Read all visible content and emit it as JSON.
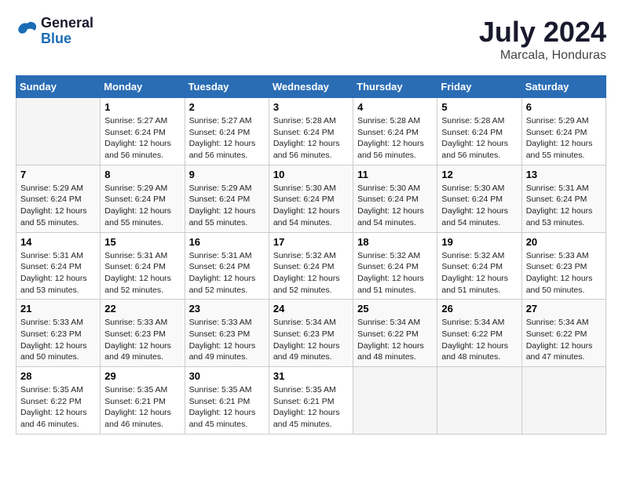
{
  "logo": {
    "line1": "General",
    "line2": "Blue"
  },
  "title": "July 2024",
  "subtitle": "Marcala, Honduras",
  "days_header": [
    "Sunday",
    "Monday",
    "Tuesday",
    "Wednesday",
    "Thursday",
    "Friday",
    "Saturday"
  ],
  "weeks": [
    [
      {
        "day": "",
        "info": ""
      },
      {
        "day": "1",
        "info": "Sunrise: 5:27 AM\nSunset: 6:24 PM\nDaylight: 12 hours\nand 56 minutes."
      },
      {
        "day": "2",
        "info": "Sunrise: 5:27 AM\nSunset: 6:24 PM\nDaylight: 12 hours\nand 56 minutes."
      },
      {
        "day": "3",
        "info": "Sunrise: 5:28 AM\nSunset: 6:24 PM\nDaylight: 12 hours\nand 56 minutes."
      },
      {
        "day": "4",
        "info": "Sunrise: 5:28 AM\nSunset: 6:24 PM\nDaylight: 12 hours\nand 56 minutes."
      },
      {
        "day": "5",
        "info": "Sunrise: 5:28 AM\nSunset: 6:24 PM\nDaylight: 12 hours\nand 56 minutes."
      },
      {
        "day": "6",
        "info": "Sunrise: 5:29 AM\nSunset: 6:24 PM\nDaylight: 12 hours\nand 55 minutes."
      }
    ],
    [
      {
        "day": "7",
        "info": "Sunrise: 5:29 AM\nSunset: 6:24 PM\nDaylight: 12 hours\nand 55 minutes."
      },
      {
        "day": "8",
        "info": "Sunrise: 5:29 AM\nSunset: 6:24 PM\nDaylight: 12 hours\nand 55 minutes."
      },
      {
        "day": "9",
        "info": "Sunrise: 5:29 AM\nSunset: 6:24 PM\nDaylight: 12 hours\nand 55 minutes."
      },
      {
        "day": "10",
        "info": "Sunrise: 5:30 AM\nSunset: 6:24 PM\nDaylight: 12 hours\nand 54 minutes."
      },
      {
        "day": "11",
        "info": "Sunrise: 5:30 AM\nSunset: 6:24 PM\nDaylight: 12 hours\nand 54 minutes."
      },
      {
        "day": "12",
        "info": "Sunrise: 5:30 AM\nSunset: 6:24 PM\nDaylight: 12 hours\nand 54 minutes."
      },
      {
        "day": "13",
        "info": "Sunrise: 5:31 AM\nSunset: 6:24 PM\nDaylight: 12 hours\nand 53 minutes."
      }
    ],
    [
      {
        "day": "14",
        "info": "Sunrise: 5:31 AM\nSunset: 6:24 PM\nDaylight: 12 hours\nand 53 minutes."
      },
      {
        "day": "15",
        "info": "Sunrise: 5:31 AM\nSunset: 6:24 PM\nDaylight: 12 hours\nand 52 minutes."
      },
      {
        "day": "16",
        "info": "Sunrise: 5:31 AM\nSunset: 6:24 PM\nDaylight: 12 hours\nand 52 minutes."
      },
      {
        "day": "17",
        "info": "Sunrise: 5:32 AM\nSunset: 6:24 PM\nDaylight: 12 hours\nand 52 minutes."
      },
      {
        "day": "18",
        "info": "Sunrise: 5:32 AM\nSunset: 6:24 PM\nDaylight: 12 hours\nand 51 minutes."
      },
      {
        "day": "19",
        "info": "Sunrise: 5:32 AM\nSunset: 6:24 PM\nDaylight: 12 hours\nand 51 minutes."
      },
      {
        "day": "20",
        "info": "Sunrise: 5:33 AM\nSunset: 6:23 PM\nDaylight: 12 hours\nand 50 minutes."
      }
    ],
    [
      {
        "day": "21",
        "info": "Sunrise: 5:33 AM\nSunset: 6:23 PM\nDaylight: 12 hours\nand 50 minutes."
      },
      {
        "day": "22",
        "info": "Sunrise: 5:33 AM\nSunset: 6:23 PM\nDaylight: 12 hours\nand 49 minutes."
      },
      {
        "day": "23",
        "info": "Sunrise: 5:33 AM\nSunset: 6:23 PM\nDaylight: 12 hours\nand 49 minutes."
      },
      {
        "day": "24",
        "info": "Sunrise: 5:34 AM\nSunset: 6:23 PM\nDaylight: 12 hours\nand 49 minutes."
      },
      {
        "day": "25",
        "info": "Sunrise: 5:34 AM\nSunset: 6:22 PM\nDaylight: 12 hours\nand 48 minutes."
      },
      {
        "day": "26",
        "info": "Sunrise: 5:34 AM\nSunset: 6:22 PM\nDaylight: 12 hours\nand 48 minutes."
      },
      {
        "day": "27",
        "info": "Sunrise: 5:34 AM\nSunset: 6:22 PM\nDaylight: 12 hours\nand 47 minutes."
      }
    ],
    [
      {
        "day": "28",
        "info": "Sunrise: 5:35 AM\nSunset: 6:22 PM\nDaylight: 12 hours\nand 46 minutes."
      },
      {
        "day": "29",
        "info": "Sunrise: 5:35 AM\nSunset: 6:21 PM\nDaylight: 12 hours\nand 46 minutes."
      },
      {
        "day": "30",
        "info": "Sunrise: 5:35 AM\nSunset: 6:21 PM\nDaylight: 12 hours\nand 45 minutes."
      },
      {
        "day": "31",
        "info": "Sunrise: 5:35 AM\nSunset: 6:21 PM\nDaylight: 12 hours\nand 45 minutes."
      },
      {
        "day": "",
        "info": ""
      },
      {
        "day": "",
        "info": ""
      },
      {
        "day": "",
        "info": ""
      }
    ]
  ]
}
